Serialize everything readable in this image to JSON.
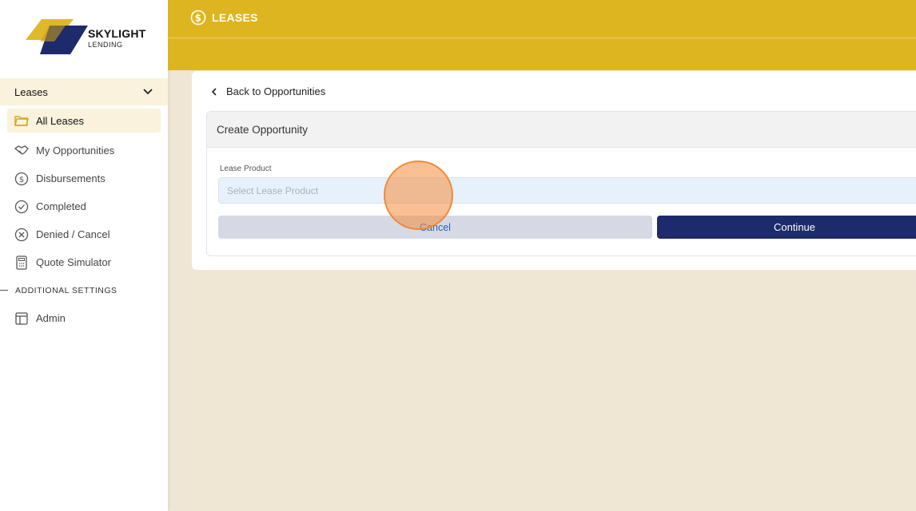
{
  "brand": {
    "name": "SKYLIGHT",
    "sub": "LENDING",
    "colors": {
      "gold": "#ddb520",
      "navy": "#1d2a6b",
      "sand": "#efe7d4"
    }
  },
  "sidebar": {
    "section": {
      "label": "Leases",
      "icon": "chevron-down-icon"
    },
    "items": [
      {
        "label": "All Leases",
        "icon": "folder-icon",
        "active": true
      },
      {
        "label": "My Opportunities",
        "icon": "handshake-icon"
      },
      {
        "label": "Disbursements",
        "icon": "dollar-circle-icon"
      },
      {
        "label": "Completed",
        "icon": "check-circle-icon"
      },
      {
        "label": "Denied / Cancel",
        "icon": "x-circle-icon"
      },
      {
        "label": "Quote Simulator",
        "icon": "calculator-icon"
      }
    ],
    "settings_label": "ADDITIONAL SETTINGS",
    "settings_items": [
      {
        "label": "Admin",
        "icon": "layout-icon"
      }
    ]
  },
  "header": {
    "title": "LEASES",
    "icon": "dollar-circle-icon"
  },
  "main": {
    "back_label": "Back to Opportunities",
    "panel_title": "Create Opportunity",
    "field_label": "Lease Product",
    "select_placeholder": "Select Lease Product",
    "cancel_label": "Cancel",
    "continue_label": "Continue"
  }
}
